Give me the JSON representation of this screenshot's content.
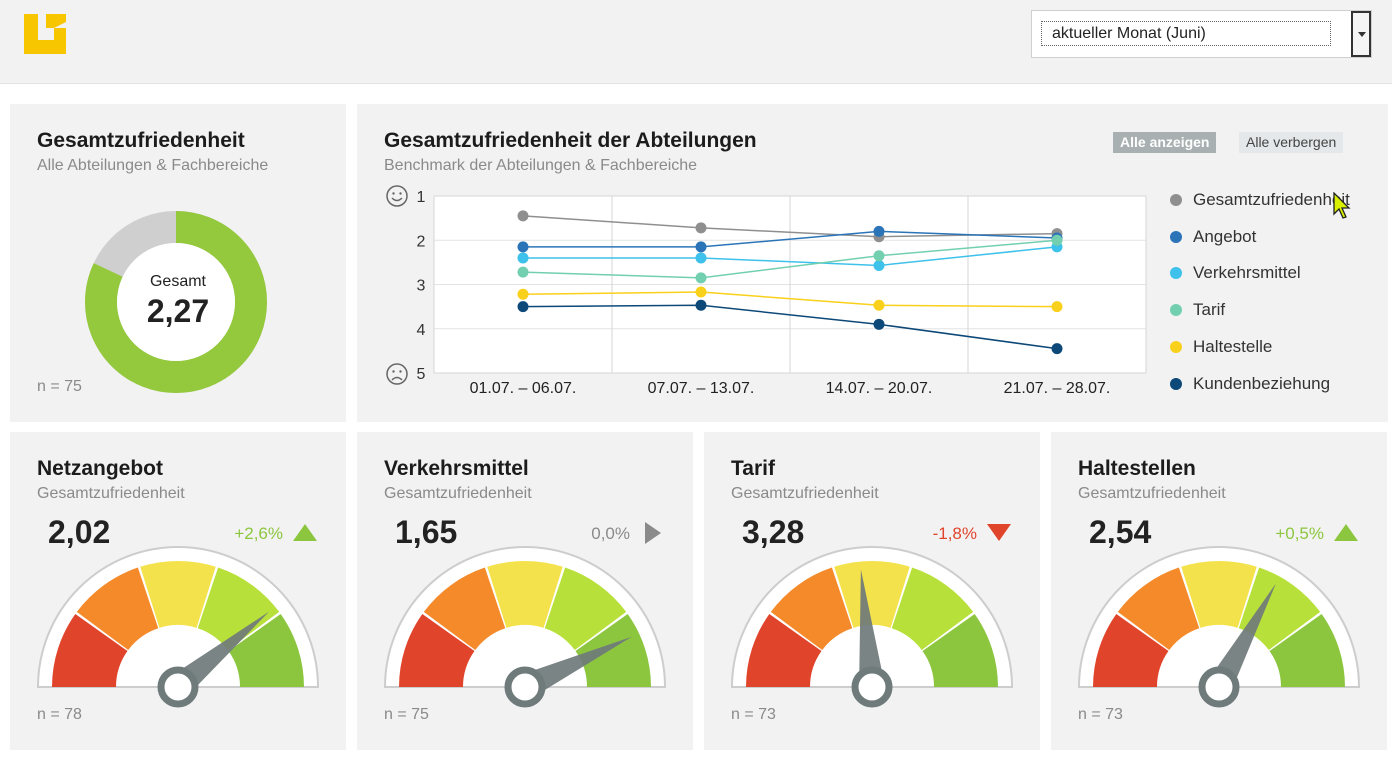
{
  "header": {
    "logo_icon": "brand-logo-icon",
    "period_select": {
      "selected": "aktueller Monat (Juni)"
    }
  },
  "overall": {
    "title": "Gesamtzufriedenheit",
    "subtitle": "Alle Abteilungen & Fachbereiche",
    "center_label": "Gesamt",
    "value": "2,27",
    "n": "n = 75",
    "fill_fraction": 0.82,
    "colors": {
      "fill": "#95c93d",
      "rest": "#cfcfcf"
    }
  },
  "departments": {
    "title": "Gesamtzufriedenheit der Abteilungen",
    "subtitle": "Benchmark der Abteilungen & Fachbereiche",
    "show_all": "Alle anzeigen",
    "hide_all": "Alle verbergen",
    "icons": {
      "top": "happy-face-icon",
      "bottom": "sad-face-icon"
    }
  },
  "chart_data": {
    "type": "line",
    "categories": [
      "01.07. – 06.07.",
      "07.07. – 13.07.",
      "14.07. – 20.07.",
      "21.07. – 28.07."
    ],
    "y_ticks": [
      "1",
      "2",
      "3",
      "4",
      "5"
    ],
    "ylim": [
      1,
      5
    ],
    "y_inverted": true,
    "grid": true,
    "legend_position": "right",
    "series": [
      {
        "name": "Gesamtzufriedenheit",
        "color": "#8f8f8f",
        "values": [
          1.45,
          1.72,
          1.92,
          1.85
        ]
      },
      {
        "name": "Angebot",
        "color": "#2b74b8",
        "values": [
          2.15,
          2.15,
          1.8,
          1.95
        ]
      },
      {
        "name": "Verkehrsmittel",
        "color": "#3ec1ea",
        "values": [
          2.4,
          2.4,
          2.57,
          2.15
        ]
      },
      {
        "name": "Tarif",
        "color": "#72cfb0",
        "values": [
          2.72,
          2.85,
          2.35,
          2.0
        ]
      },
      {
        "name": "Haltestelle",
        "color": "#f9d01a",
        "values": [
          3.22,
          3.17,
          3.47,
          3.5
        ]
      },
      {
        "name": "Kundenbeziehung",
        "color": "#0c4878",
        "values": [
          3.5,
          3.47,
          3.9,
          4.45
        ]
      }
    ]
  },
  "gauges": [
    {
      "title": "Netzangebot",
      "subtitle": "Gesamtzufriedenheit",
      "value": "2,02",
      "change": "+2,6%",
      "trend": "up",
      "trend_color": "#8cc63f",
      "needle_fraction": 0.78,
      "n": "n = 78"
    },
    {
      "title": "Verkehrsmittel",
      "subtitle": "Gesamtzufriedenheit",
      "value": "1,65",
      "change": "0,0%",
      "trend": "flat",
      "trend_color": "#8a8a8a",
      "needle_fraction": 0.86,
      "n": "n = 75"
    },
    {
      "title": "Tarif",
      "subtitle": "Gesamtzufriedenheit",
      "value": "3,28",
      "change": "-1,8%",
      "trend": "down",
      "trend_color": "#e0452c",
      "needle_fraction": 0.47,
      "n": "n = 73"
    },
    {
      "title": "Haltestellen",
      "subtitle": "Gesamtzufriedenheit",
      "value": "2,54",
      "change": "+0,5%",
      "trend": "up",
      "trend_color": "#8cc63f",
      "needle_fraction": 0.66,
      "n": "n = 73"
    }
  ],
  "gauge_segment_colors": [
    "#e0452c",
    "#f58a2b",
    "#f4e24c",
    "#b8e03a",
    "#8cc63f"
  ]
}
